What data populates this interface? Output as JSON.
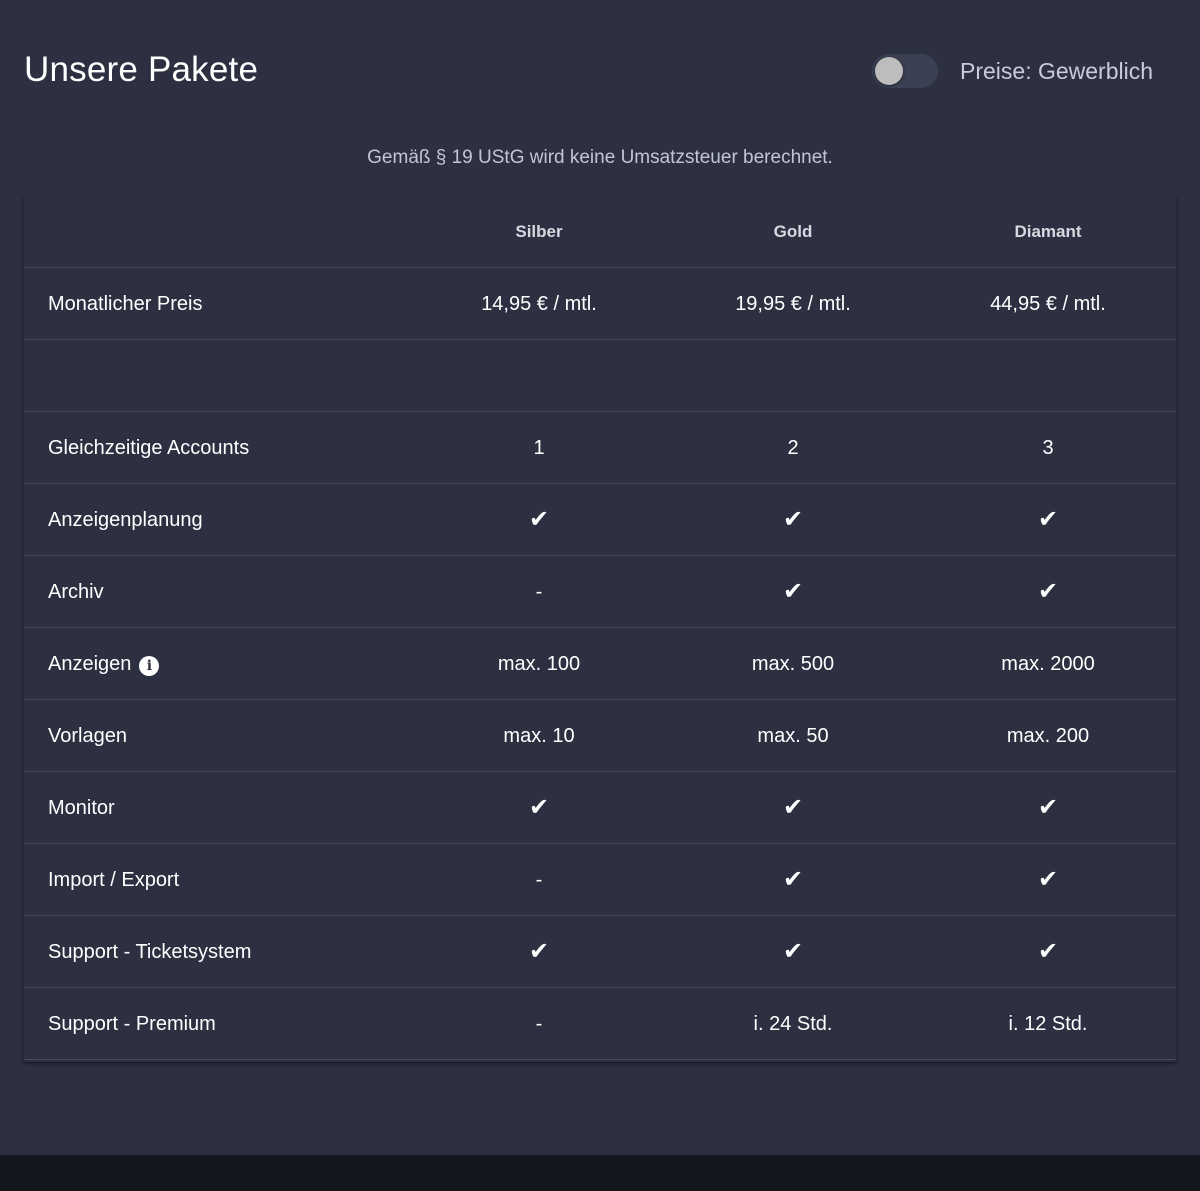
{
  "header": {
    "title": "Unsere Pakete",
    "toggle_label": "Preise: Gewerblich",
    "toggle_on": false
  },
  "tax_note": "Gemäß § 19 UStG wird keine Umsatzsteuer berechnet.",
  "table": {
    "columns": [
      "",
      "Silber",
      "Gold",
      "Diamant"
    ],
    "rows": [
      {
        "label": "Monatlicher Preis",
        "values": [
          "14,95 € / mtl.",
          "19,95 € / mtl.",
          "44,95 € / mtl."
        ]
      },
      {
        "label": "",
        "values": [
          "",
          "",
          ""
        ]
      },
      {
        "label": "Gleichzeitige Accounts",
        "values": [
          "1",
          "2",
          "3"
        ]
      },
      {
        "label": "Anzeigenplanung",
        "values": [
          "✔",
          "✔",
          "✔"
        ]
      },
      {
        "label": "Archiv",
        "values": [
          "-",
          "✔",
          "✔"
        ]
      },
      {
        "label": "Anzeigen",
        "info_icon": "info-icon",
        "info_glyph": "i",
        "values": [
          "max. 100",
          "max. 500",
          "max. 2000"
        ]
      },
      {
        "label": "Vorlagen",
        "values": [
          "max. 10",
          "max. 50",
          "max. 200"
        ]
      },
      {
        "label": "Monitor",
        "values": [
          "✔",
          "✔",
          "✔"
        ]
      },
      {
        "label": "Import / Export",
        "values": [
          "-",
          "✔",
          "✔"
        ]
      },
      {
        "label": "Support - Ticketsystem",
        "values": [
          "✔",
          "✔",
          "✔"
        ]
      },
      {
        "label": "Support - Premium",
        "values": [
          "-",
          "i. 24 Std.",
          "i. 12 Std."
        ]
      }
    ]
  },
  "colors": {
    "card_background": "#2c3041",
    "page_background": "#15171f",
    "divider": "#434859"
  }
}
